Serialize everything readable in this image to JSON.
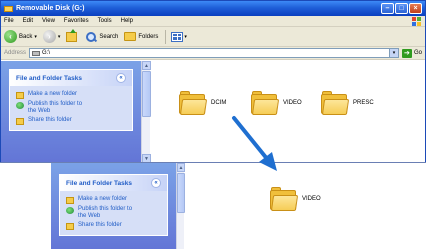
{
  "window": {
    "title": "Removable Disk (G:)"
  },
  "menubar": {
    "items": [
      "File",
      "Edit",
      "View",
      "Favorites",
      "Tools",
      "Help"
    ]
  },
  "toolbar": {
    "back_label": "Back",
    "search_label": "Search",
    "folders_label": "Folders"
  },
  "addressbar": {
    "label": "Address",
    "value": "G:\\",
    "go_label": "Go"
  },
  "taskpane": {
    "title": "File and Folder Tasks",
    "collapse_glyph": "«",
    "tasks": [
      "Make a new folder",
      "Publish this folder to the Web",
      "Share this folder"
    ]
  },
  "files_top": [
    "DCIM",
    "VIDEO",
    "PRESC"
  ],
  "lower_view": {
    "taskpane_title": "File and Folder Tasks",
    "collapse_glyph": "«",
    "tasks": [
      "Make a new folder",
      "Publish this folder to the Web",
      "Share this folder"
    ],
    "files": [
      "VIDEO"
    ]
  },
  "icons": {
    "back": "back-arrow-icon",
    "forward": "forward-arrow-icon",
    "up": "up-folder-icon",
    "search": "search-icon",
    "folders": "folders-icon",
    "views": "views-icon",
    "go": "go-arrow-icon"
  },
  "colors": {
    "titlebar": "#0a3fbf",
    "task_link": "#215dc6",
    "folder": "#f0bf3b",
    "annotation_arrow": "#1f6fd0"
  }
}
